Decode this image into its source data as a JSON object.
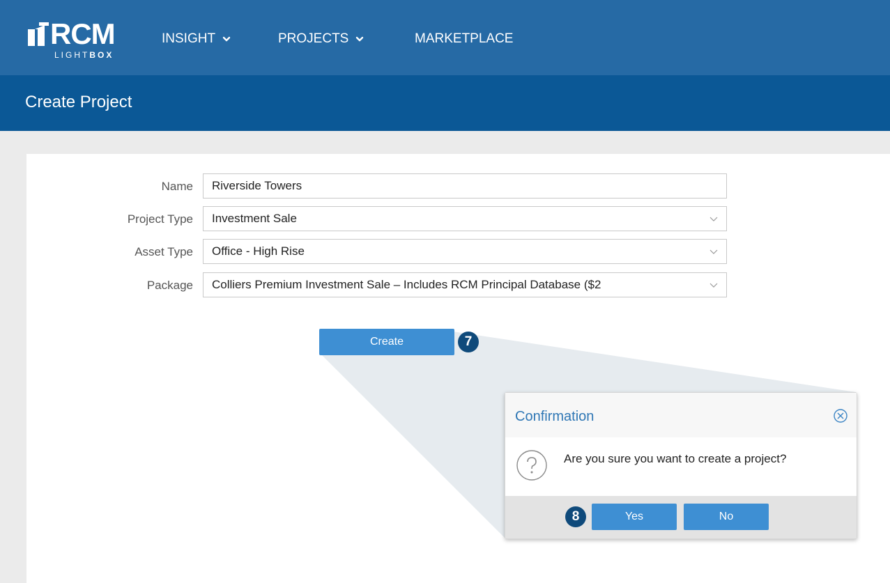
{
  "app": {
    "logo_text": "RCM",
    "logo_sub_a": "LIGHT",
    "logo_sub_b": "BOX"
  },
  "nav": {
    "items": [
      {
        "label": "INSIGHT"
      },
      {
        "label": "PROJECTS"
      },
      {
        "label": "MARKETPLACE"
      }
    ]
  },
  "page": {
    "title": "Create Project"
  },
  "form": {
    "name_label": "Name",
    "name_value": "Riverside Towers",
    "project_type_label": "Project Type",
    "project_type_value": "Investment Sale",
    "asset_type_label": "Asset Type",
    "asset_type_value": "Office - High Rise",
    "package_label": "Package",
    "package_value": "Colliers Premium Investment Sale – Includes RCM Principal Database ($2",
    "create_label": "Create"
  },
  "steps": {
    "create_step": "7",
    "yes_step": "8"
  },
  "dialog": {
    "title": "Confirmation",
    "message": "Are you sure you want to create a project?",
    "yes_label": "Yes",
    "no_label": "No"
  },
  "colors": {
    "nav_bg": "#266aa5",
    "title_bg": "#0b5896",
    "button": "#3e8fd3",
    "badge": "#0f4a7b",
    "dialog_title": "#2f77b5"
  }
}
